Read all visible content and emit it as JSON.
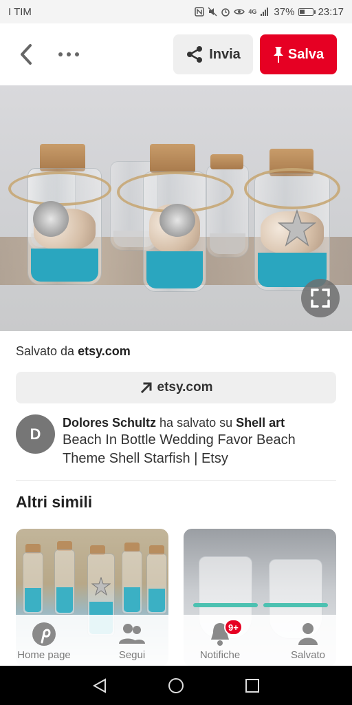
{
  "status_bar": {
    "carrier": "I TIM",
    "network": "4G",
    "battery": "37%",
    "time": "23:17"
  },
  "toolbar": {
    "back_icon": "chevron-left-icon",
    "more_icon": "more-horizontal-icon",
    "share_label": "Invia",
    "save_label": "Salva"
  },
  "saved_from": {
    "prefix": "Salvato da",
    "domain": "etsy.com"
  },
  "link_button": {
    "label": "etsy.com"
  },
  "pinner": {
    "initial": "D",
    "name": "Dolores Schultz",
    "action": "ha salvato su",
    "board": "Shell art",
    "pin_title": "Beach In Bottle Wedding Favor Beach Theme Shell Starfish | Etsy"
  },
  "similar": {
    "title": "Altri simili"
  },
  "bottom_nav": {
    "items": [
      {
        "label": "Home page",
        "icon": "pinterest-icon"
      },
      {
        "label": "Segui",
        "icon": "people-icon"
      },
      {
        "label": "Notifiche",
        "icon": "bell-icon",
        "badge": "9+"
      },
      {
        "label": "Salvato",
        "icon": "person-icon"
      }
    ]
  },
  "colors": {
    "accent": "#e60023",
    "button_bg": "#efefef",
    "avatar_bg": "#767676"
  }
}
